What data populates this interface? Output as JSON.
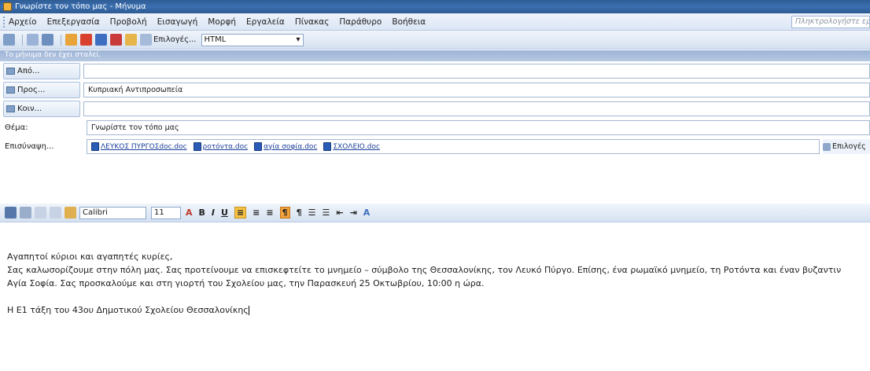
{
  "window": {
    "title": "Γνωρίστε τον τόπο μας - Μήνυμα"
  },
  "menu": {
    "items": [
      "Αρχείο",
      "Επεξεργασία",
      "Προβολή",
      "Εισαγωγή",
      "Μορφή",
      "Εργαλεία",
      "Πίνακας",
      "Παράθυρο",
      "Βοήθεια"
    ],
    "ask_placeholder": "Πληκτρολογήστε ερ"
  },
  "toolbar": {
    "options_label": "Επιλογές...",
    "format_value": "HTML"
  },
  "infobar": {
    "text": "Το μήνυμα δεν έχει σταλεί."
  },
  "header": {
    "from_label": "Από...",
    "to_label": "Προς...",
    "to_value": "Κυπριακή Αντιπροσωπεία",
    "cc_label": "Κοιν...",
    "subject_label": "Θέμα:",
    "subject_value": "Γνωρίστε τον τόπο μας",
    "attach_label": "Επισύναψη...",
    "attachments": [
      "ΛΕΥΚΟΣ ΠΥΡΓΟΣdoc.doc",
      "ροτόντα.doc",
      "αγία σοφία.doc",
      "ΣΧΟΛΕΙΟ.doc"
    ],
    "attach_options": "Επιλογές"
  },
  "format": {
    "font": "Calibri",
    "size": "11"
  },
  "message": {
    "greeting": "Αγαπητοί κύριοι και αγαπητές κυρίες,",
    "line1": "Σας καλωσορίζουμε στην πόλη μας. Σας προτείνουμε να επισκεφτείτε το μνημείο – σύμβολο της Θεσσαλονίκης, τον Λευκό Πύργο. Επίσης,  ένα ρωμαϊκό μνημείο, τη Ροτόντα και έναν βυζαντιν",
    "line2": "Αγία Σοφία. Σας προσκαλούμε και στη γιορτή του Σχολείου μας, την Παρασκευή 25 Οκτωβρίου, 10:00 η ώρα.",
    "signature": "Η Ε1 τάξη του 43ου Δημοτικού Σχολείου Θεσσαλονίκης"
  },
  "colors": {
    "titlebar": "#2f5d96",
    "toolbar": "#dbe6f5",
    "accent": "#f7c244"
  }
}
